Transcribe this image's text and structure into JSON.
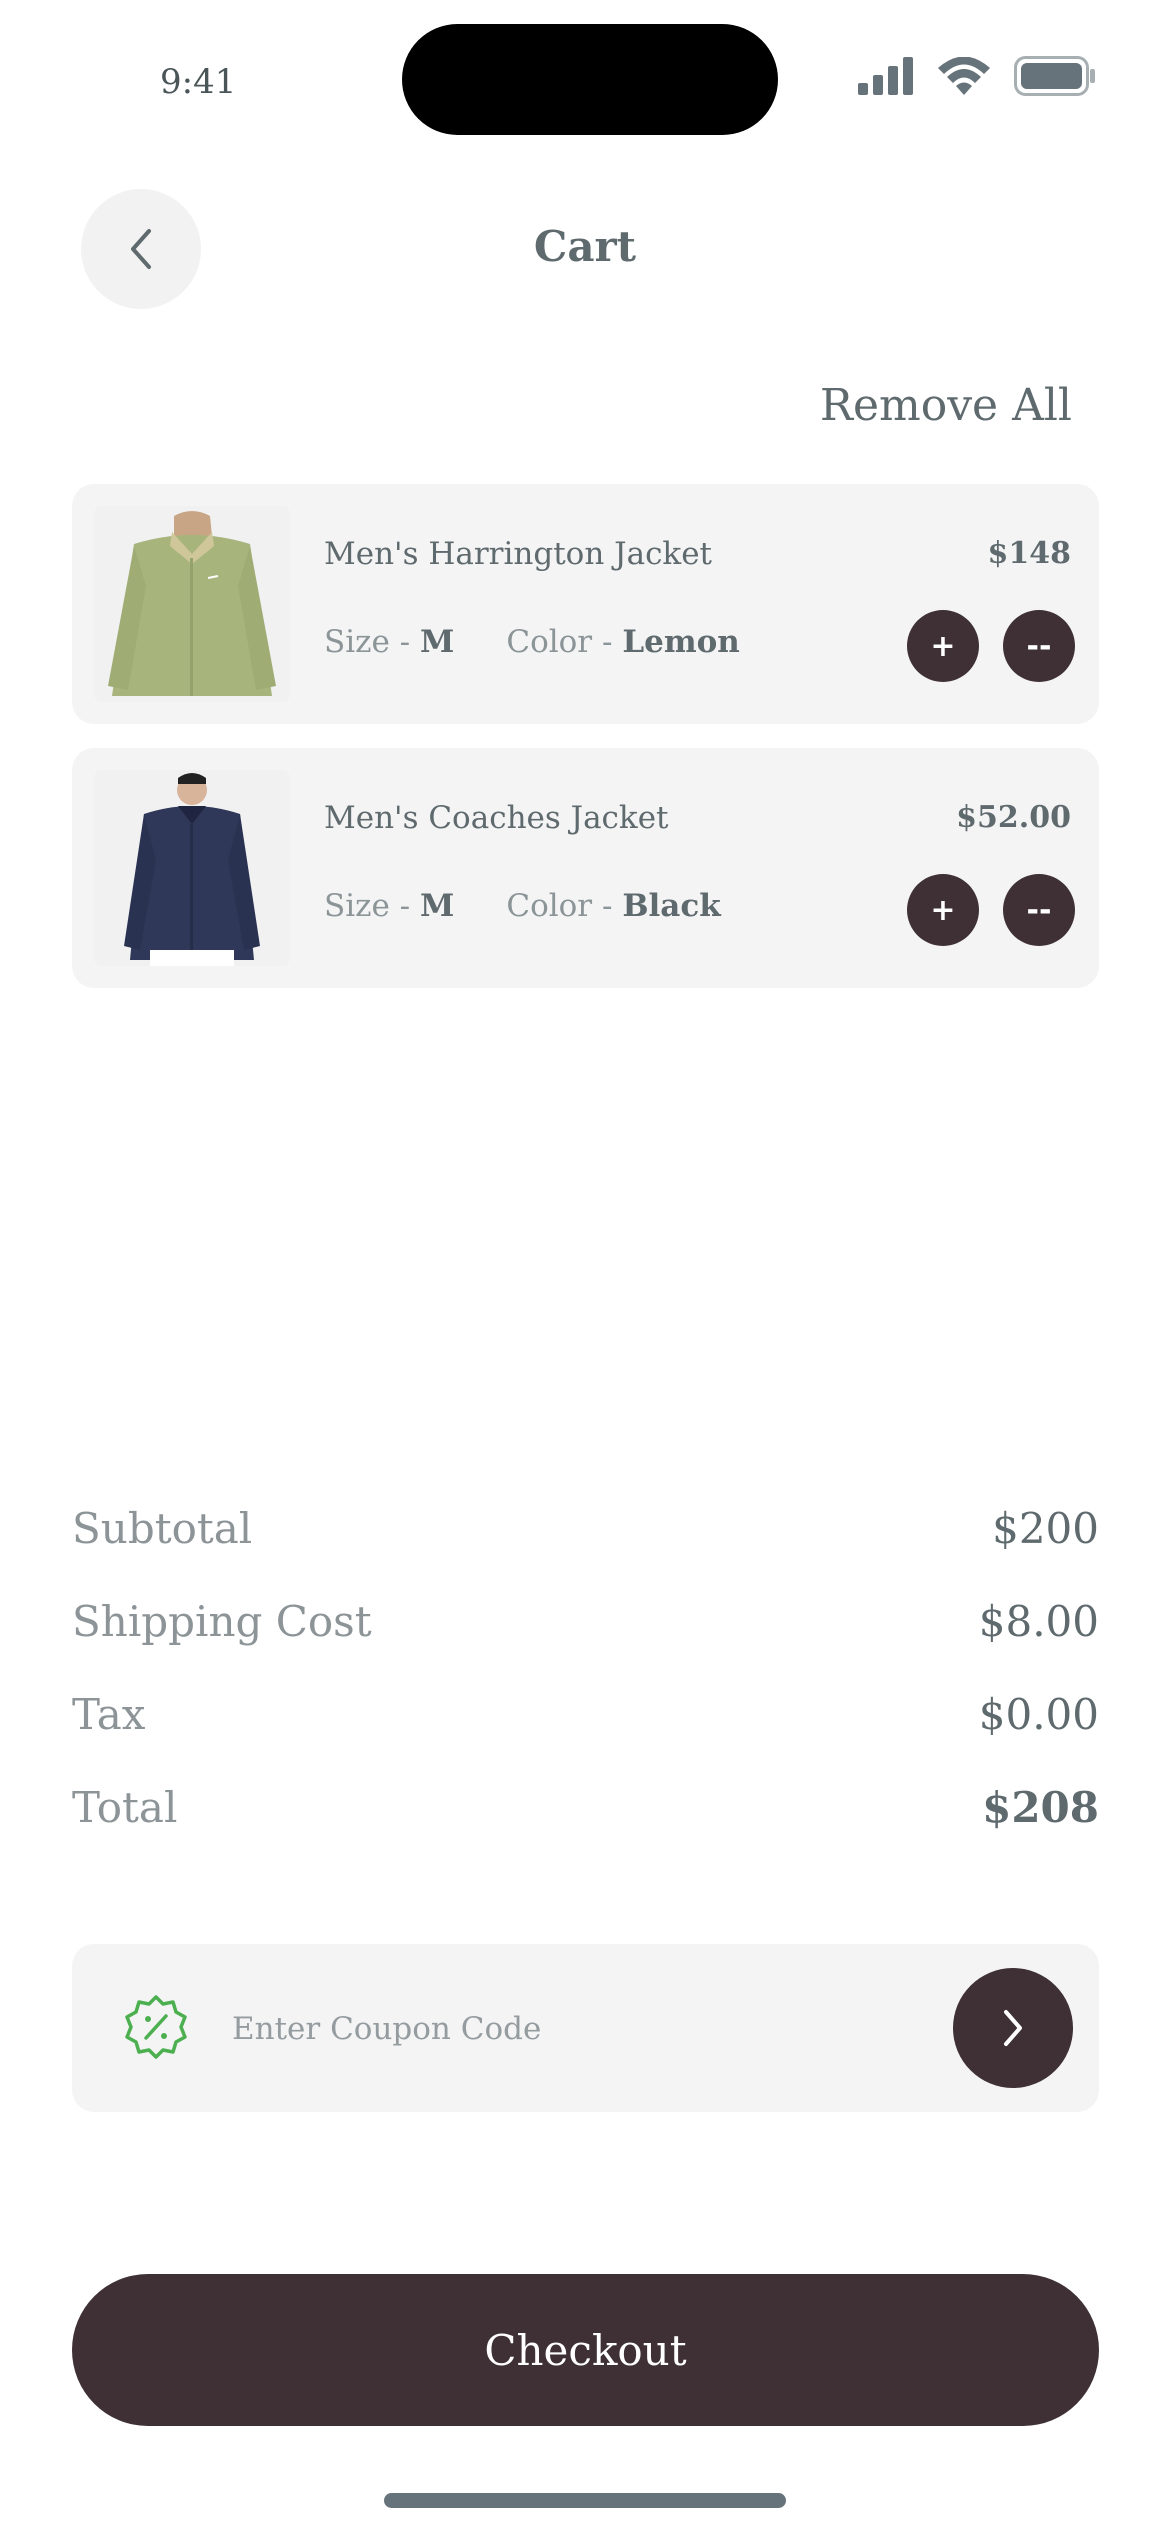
{
  "status_bar": {
    "time": "9:41"
  },
  "header": {
    "title": "Cart",
    "remove_all": "Remove All"
  },
  "items": [
    {
      "name": "Men's Harrington Jacket",
      "price": "$148",
      "size_label": "Size - ",
      "size": "M",
      "color_label": "Color - ",
      "color": "Lemon",
      "plus": "+",
      "minus": "--"
    },
    {
      "name": "Men's Coaches Jacket",
      "price": "$52.00",
      "size_label": "Size - ",
      "size": "M",
      "color_label": "Color - ",
      "color": "Black",
      "plus": "+",
      "minus": "--"
    }
  ],
  "summary": [
    {
      "label": "Subtotal",
      "value": "$200"
    },
    {
      "label": "Shipping Cost",
      "value": "$8.00"
    },
    {
      "label": "Tax",
      "value": "$0.00"
    },
    {
      "label": "Total",
      "value": "$208"
    }
  ],
  "coupon": {
    "placeholder": "Enter Coupon Code",
    "value": ""
  },
  "checkout": {
    "label": "Checkout"
  },
  "colors": {
    "accent": "#3e3034",
    "card": "#f4f4f4",
    "coupon_icon": "#4caf50",
    "text": "#5f6a6e"
  },
  "icons": [
    "back-chevron-icon",
    "signal-icon",
    "wifi-icon",
    "battery-icon",
    "discount-badge-icon",
    "chevron-right-icon"
  ]
}
